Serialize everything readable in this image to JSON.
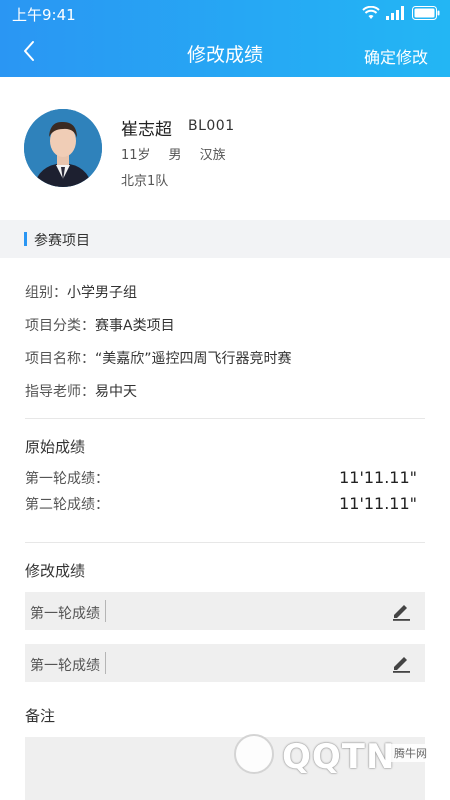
{
  "status_bar": {
    "time": "上午9:41"
  },
  "nav": {
    "title": "修改成绩",
    "confirm_label": "确定修改"
  },
  "student": {
    "name": "崔志超",
    "id": "BL001",
    "age": "11岁",
    "gender": "男",
    "ethnicity": "汉族",
    "team": "北京1队"
  },
  "section": {
    "title": "参赛项目"
  },
  "info": [
    {
      "key": "组别：",
      "value": "小学男子组"
    },
    {
      "key": "项目分类：",
      "value": "赛事A类项目"
    },
    {
      "key": "项目名称：",
      "value": "“美嘉欣”遥控四周飞行器竞时赛"
    },
    {
      "key": "指导老师：",
      "value": "易中天"
    }
  ],
  "original": {
    "title": "原始成绩",
    "rows": [
      {
        "key": "第一轮成绩：",
        "value": "11'11.11\""
      },
      {
        "key": "第二轮成绩：",
        "value": "11'11.11\""
      }
    ]
  },
  "modify": {
    "title": "修改成绩",
    "inputs": [
      {
        "label": "第一轮成绩",
        "value": ""
      },
      {
        "label": "第一轮成绩",
        "value": ""
      }
    ]
  },
  "remark": {
    "title": "备注",
    "value": ""
  },
  "watermark": {
    "text": "QQTN",
    "sub": "腾牛网"
  },
  "colors": {
    "header_start": "#2a96f3",
    "header_end": "#23b6f4",
    "accent": "#2a96f3"
  }
}
